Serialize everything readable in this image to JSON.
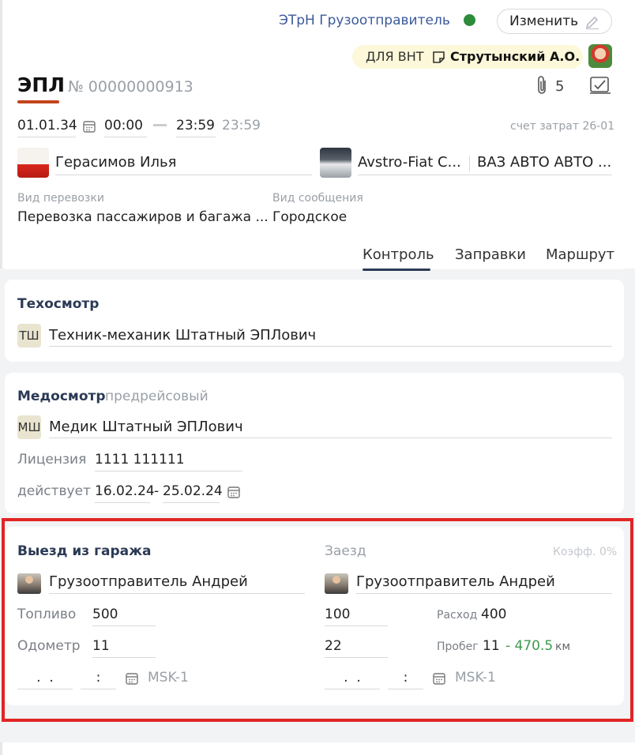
{
  "header": {
    "shipper_link": "ЭТрН Грузоотправитель",
    "status_color": "#2e8b3a",
    "edit_label": "Изменить",
    "vnt_prefix": "ДЛЯ ВНТ",
    "vnt_person": "Струтынский А.О.",
    "doc_type": "ЭПЛ",
    "doc_number": "№ 00000000913",
    "attachments_count": "5",
    "accent_color": "#c4441b"
  },
  "period": {
    "date": "01.01.34",
    "time_from": "00:00",
    "time_to": "23:59",
    "time_to_hint": "23:59",
    "cost_account": "счет затрат 26-01"
  },
  "driver": {
    "name": "Герасимов Илья"
  },
  "vehicle": {
    "model": "Avstro-Fiat C...",
    "owner": "ВАЗ АВТО АВТО ..."
  },
  "transport": {
    "type_label": "Вид перевозки",
    "type_value": "Перевозка пассажиров и багажа ...",
    "message_label": "Вид сообщения",
    "message_value": "Городское"
  },
  "tabs": [
    {
      "label": "Контроль"
    },
    {
      "label": "Заправки"
    },
    {
      "label": "Маршрут"
    }
  ],
  "tech_inspection": {
    "title": "Техосмотр",
    "initials": "ТШ",
    "person": "Техник-механик Штатный ЭПЛович"
  },
  "med_inspection": {
    "title": "Медосмотр",
    "subtitle": "предрейсовый",
    "initials": "МШ",
    "person": "Медик Штатный ЭПЛович",
    "license_label": "Лицензия",
    "license_value": "1111 111111",
    "valid_label": "действует",
    "valid_from": "16.02.24",
    "valid_sep": "-",
    "valid_to": "25.02.24"
  },
  "departure": {
    "title": "Выезд из гаража",
    "person": "Грузоотправитель Андрей",
    "fuel_label": "Топливо",
    "fuel_value": "500",
    "odometer_label": "Одометр",
    "odometer_value": "11",
    "date_placeholder": " .  . ",
    "time_placeholder": ":",
    "timezone": "MSK-1"
  },
  "arrival": {
    "title": "Заезд",
    "coef": "Коэфф. 0%",
    "person": "Грузоотправитель Андрей",
    "fuel_value": "100",
    "consumption_label": "Расход",
    "consumption_value": "400",
    "odometer_value": "22",
    "mileage_label": "Пробег",
    "mileage_value": "11",
    "mileage_extra": "- 470.5",
    "mileage_unit": "км",
    "date_placeholder": " .  . ",
    "time_placeholder": ":",
    "timezone": "MSK-1"
  }
}
